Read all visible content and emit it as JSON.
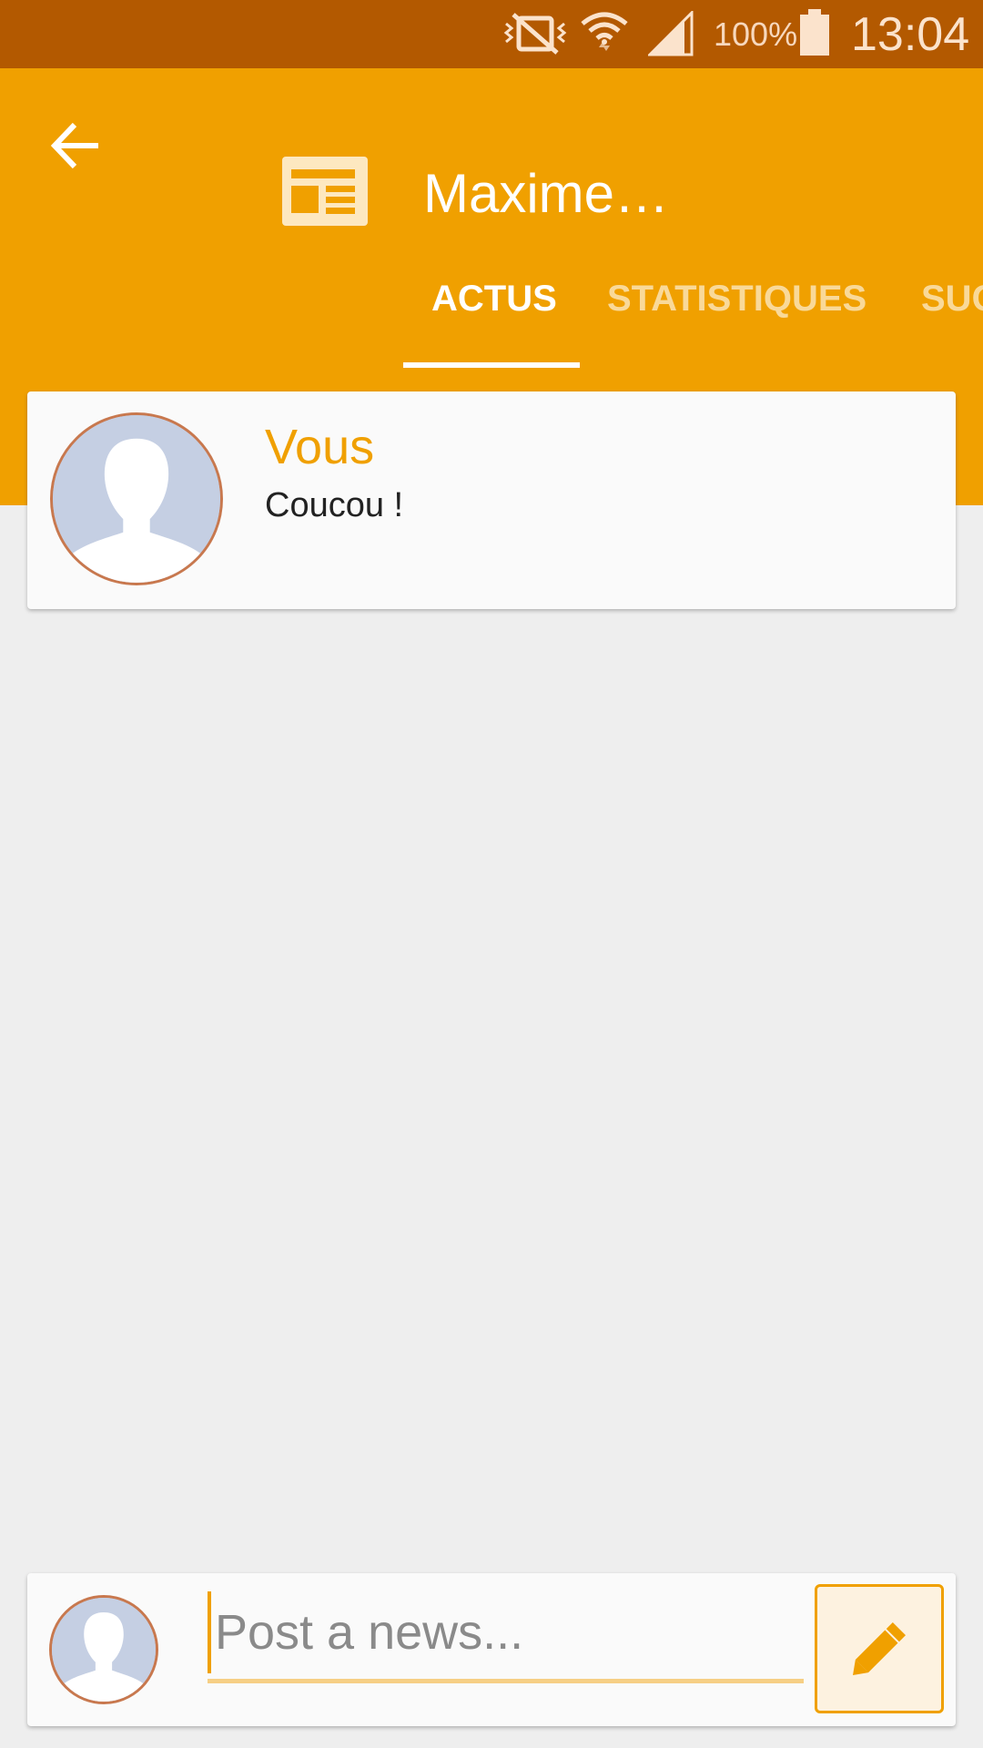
{
  "status_bar": {
    "battery": "100%",
    "time": "13:04",
    "icons": [
      "vibrate-off-icon",
      "wifi-icon",
      "signal-icon",
      "battery-icon"
    ]
  },
  "header": {
    "title": "Maxime…",
    "back_icon": "arrow-left-icon",
    "logo_icon": "newspaper-icon"
  },
  "tabs": [
    {
      "label": "ACTUS",
      "active": true
    },
    {
      "label": "STATISTIQUES",
      "active": false
    },
    {
      "label": "SUC",
      "active": false
    }
  ],
  "feed": [
    {
      "author": "Vous",
      "message": "Coucou !",
      "avatar_icon": "default-avatar-icon"
    }
  ],
  "composer": {
    "placeholder": "Post a news...",
    "submit_icon": "pencil-icon"
  },
  "colors": {
    "accent": "#f0a000",
    "status_bar": "#b35900",
    "background": "#eeeeee",
    "avatar_bg": "#c5cfe3"
  }
}
